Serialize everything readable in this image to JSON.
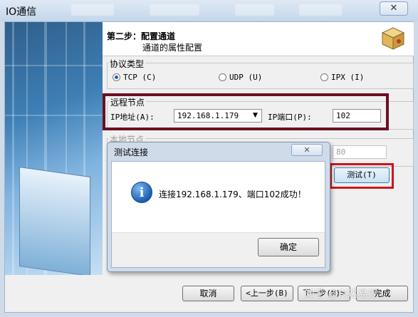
{
  "window": {
    "title": "IO通信",
    "close_label": "✕"
  },
  "header": {
    "step_title": "第二步：配置通道",
    "step_subtitle": "通道的属性配置"
  },
  "protocol": {
    "group_label": "协议类型",
    "options": [
      {
        "label": "TCP (C)",
        "selected": true
      },
      {
        "label": "UDP (U)",
        "selected": false
      },
      {
        "label": "IPX (I)",
        "selected": false
      }
    ]
  },
  "remote": {
    "group_label": "远程节点",
    "ip_label": "IP地址(A):",
    "ip_value": "192.168.1.179",
    "port_label": "IP端口(P):",
    "port_value": "102"
  },
  "local": {
    "group_label": "本地节点",
    "port_value": "80",
    "test_button": "测试(T)"
  },
  "dialog": {
    "title": "测试连接",
    "message": "连接192.168.1.179、端口102成功！",
    "ok_button": "确定"
  },
  "footer": {
    "cancel": "取消",
    "prev": "<上一步(B)",
    "next": "下一步(N)>",
    "finish": "完成"
  },
  "watermark": "知乎 @兴达易控",
  "colors": {
    "highlight_red": "#d0141c",
    "highlight_dark": "#6b1020"
  }
}
